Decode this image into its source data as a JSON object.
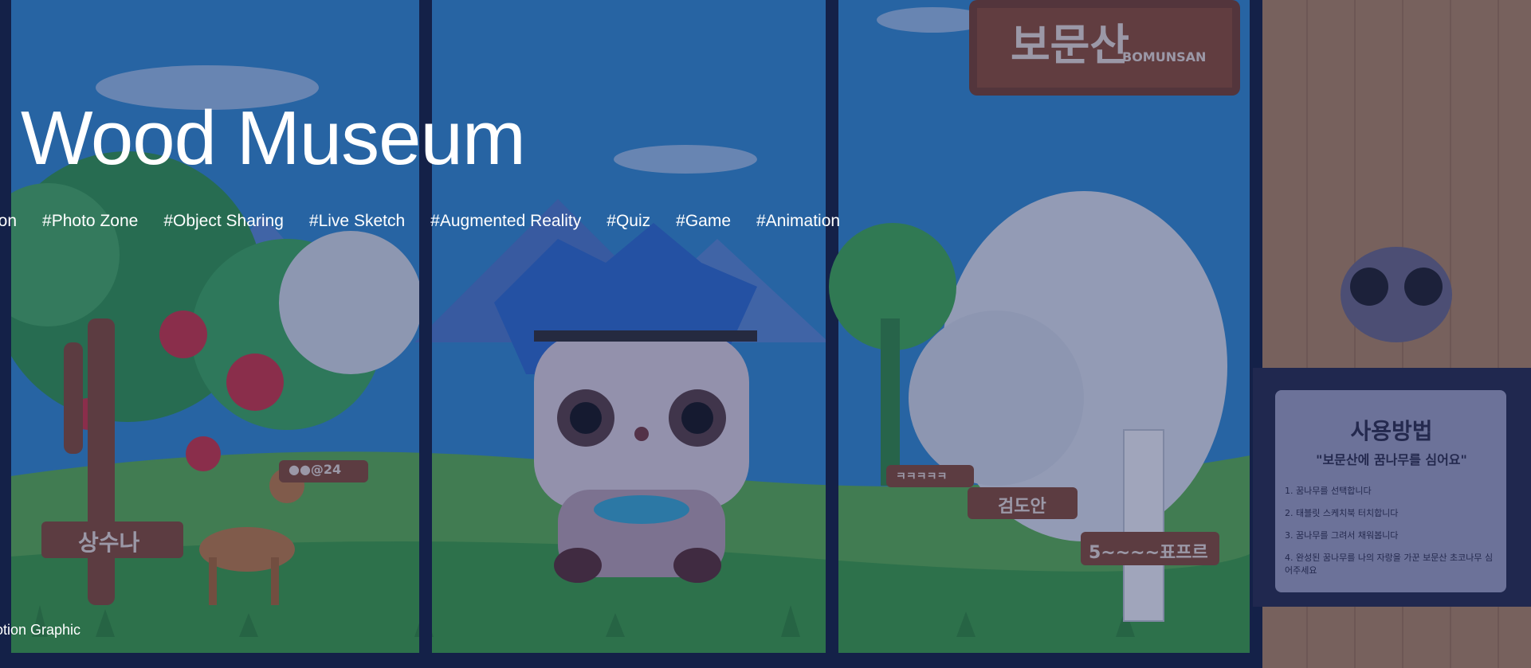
{
  "hero": {
    "title": "Wood Museum",
    "tags": [
      "eon",
      "#Photo Zone",
      "#Object Sharing",
      "#Live Sketch",
      "#Augmented Reality",
      "#Quiz",
      "#Game",
      "#Animation"
    ],
    "caption": "otion Graphic"
  },
  "mural": {
    "top_sign": "보문산",
    "top_sign_sub": "BOMUNSAN",
    "left_sign": "상수나",
    "center_sign": "검도안",
    "right_sign": "5~~~~표프르",
    "small_sign_1": "●●@24",
    "small_sign_2": "ㅋㅋㅋㅋㅋ",
    "notice_title": "사용방법",
    "notice_subtitle": "\"보문산에 꿈나무를 심어요\"",
    "notice_steps": [
      "1. 꿈나무를 선택합니다",
      "2. 태블릿 스케치북 터치합니다",
      "3. 꿈나무를 그려서 채워봅니다",
      "4. 완성된 꿈나무를 나의 자랑을 가꾼 보문산 초코나무 심어주세요"
    ]
  },
  "colors": {
    "sky": "#2f8fd6",
    "grass": "#3aa63f",
    "wood_panel": "#b98a5e",
    "overlay": "#1c285c"
  }
}
